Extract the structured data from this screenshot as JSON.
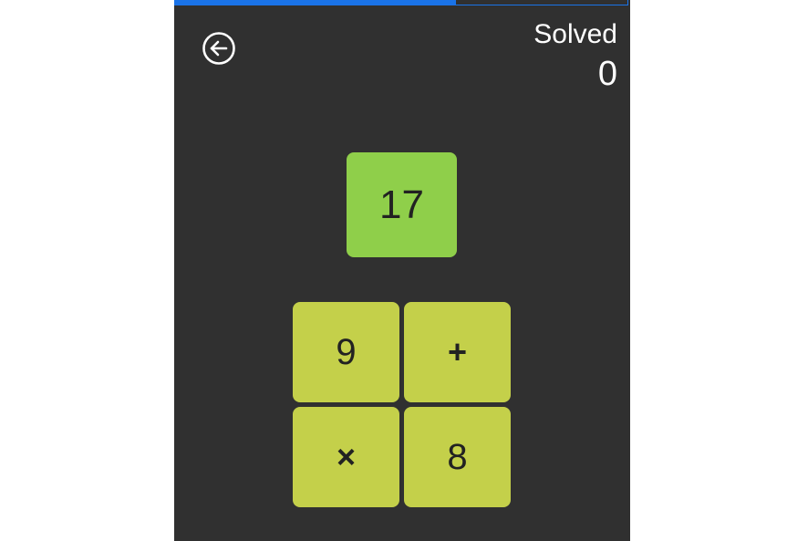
{
  "progress": {
    "fraction": 0.62,
    "color": "#1a73e8"
  },
  "header": {
    "back_icon": "arrow-left-circle-icon",
    "score_label": "Solved",
    "score_value": "0"
  },
  "target": {
    "value": "17",
    "color": "#8fcf4a"
  },
  "tiles": [
    {
      "label": "9",
      "kind": "number"
    },
    {
      "label": "+",
      "kind": "operator"
    },
    {
      "label": "×",
      "kind": "operator"
    },
    {
      "label": "8",
      "kind": "number"
    }
  ],
  "colors": {
    "background": "#303030",
    "tile": "#c4d04a"
  }
}
